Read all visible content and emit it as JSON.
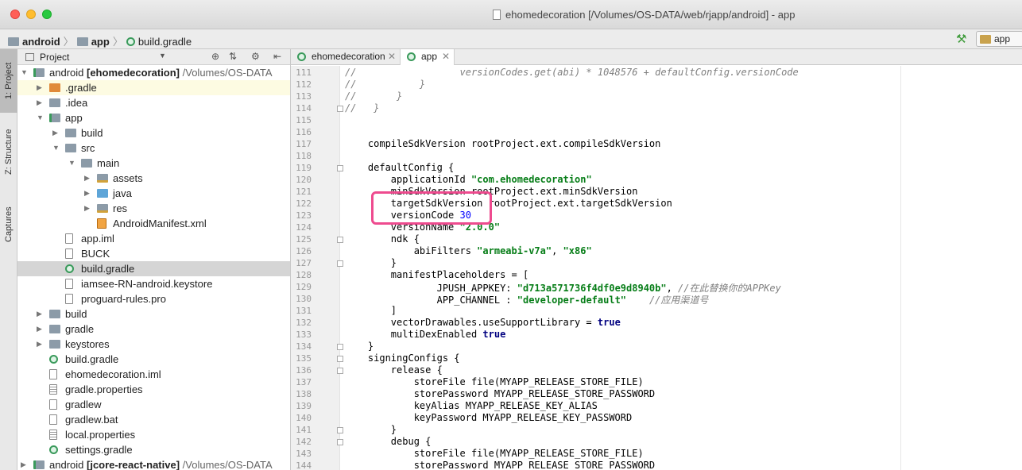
{
  "window": {
    "title": "ehomedecoration [/Volumes/OS-DATA/web/rjapp/android] - app"
  },
  "breadcrumb": {
    "items": [
      "android",
      "app",
      "build.gradle"
    ]
  },
  "toolbar": {
    "run_config": "app"
  },
  "side_tabs": [
    "1: Project",
    "Z: Structure",
    "Captures"
  ],
  "project_panel": {
    "header": "Project",
    "tree": [
      {
        "indent": 0,
        "arrow": "▼",
        "icon": "module",
        "name": "android",
        "bold": "[ehomedecoration]",
        "path": "/Volumes/OS-DATA"
      },
      {
        "indent": 1,
        "arrow": "▶",
        "icon": "folder-orange",
        "name": ".gradle",
        "hl": true
      },
      {
        "indent": 1,
        "arrow": "▶",
        "icon": "folder",
        "name": ".idea"
      },
      {
        "indent": 1,
        "arrow": "▼",
        "icon": "module",
        "name": "app"
      },
      {
        "indent": 2,
        "arrow": "▶",
        "icon": "folder",
        "name": "build"
      },
      {
        "indent": 2,
        "arrow": "▼",
        "icon": "folder",
        "name": "src"
      },
      {
        "indent": 3,
        "arrow": "▼",
        "icon": "folder",
        "name": "main"
      },
      {
        "indent": 4,
        "arrow": "▶",
        "icon": "res",
        "name": "assets"
      },
      {
        "indent": 4,
        "arrow": "▶",
        "icon": "folder-blue",
        "name": "java"
      },
      {
        "indent": 4,
        "arrow": "▶",
        "icon": "res",
        "name": "res"
      },
      {
        "indent": 4,
        "arrow": "",
        "icon": "xml",
        "name": "AndroidManifest.xml"
      },
      {
        "indent": 2,
        "arrow": "",
        "icon": "file",
        "name": "app.iml"
      },
      {
        "indent": 2,
        "arrow": "",
        "icon": "file",
        "name": "BUCK"
      },
      {
        "indent": 2,
        "arrow": "",
        "icon": "gradle",
        "name": "build.gradle",
        "selected": true
      },
      {
        "indent": 2,
        "arrow": "",
        "icon": "file",
        "name": "iamsee-RN-android.keystore"
      },
      {
        "indent": 2,
        "arrow": "",
        "icon": "file",
        "name": "proguard-rules.pro"
      },
      {
        "indent": 1,
        "arrow": "▶",
        "icon": "folder",
        "name": "build"
      },
      {
        "indent": 1,
        "arrow": "▶",
        "icon": "folder",
        "name": "gradle"
      },
      {
        "indent": 1,
        "arrow": "▶",
        "icon": "folder",
        "name": "keystores"
      },
      {
        "indent": 1,
        "arrow": "",
        "icon": "gradle",
        "name": "build.gradle"
      },
      {
        "indent": 1,
        "arrow": "",
        "icon": "file",
        "name": "ehomedecoration.iml"
      },
      {
        "indent": 1,
        "arrow": "",
        "icon": "props",
        "name": "gradle.properties"
      },
      {
        "indent": 1,
        "arrow": "",
        "icon": "file",
        "name": "gradlew"
      },
      {
        "indent": 1,
        "arrow": "",
        "icon": "file",
        "name": "gradlew.bat"
      },
      {
        "indent": 1,
        "arrow": "",
        "icon": "props",
        "name": "local.properties"
      },
      {
        "indent": 1,
        "arrow": "",
        "icon": "gradle",
        "name": "settings.gradle"
      },
      {
        "indent": 0,
        "arrow": "▶",
        "icon": "module",
        "name": "android",
        "bold": "[jcore-react-native]",
        "path": "/Volumes/OS-DATA"
      }
    ]
  },
  "editor": {
    "tabs": [
      {
        "label": "ehomedecoration",
        "active": false
      },
      {
        "label": "app",
        "active": true
      }
    ],
    "lines": [
      {
        "n": 111,
        "segs": [
          [
            "cmt",
            "//                  versionCodes.get(abi) * 1048576 + defaultConfig.versionCode"
          ]
        ]
      },
      {
        "n": 112,
        "segs": [
          [
            "cmt",
            "//           }"
          ]
        ]
      },
      {
        "n": 113,
        "segs": [
          [
            "cmt",
            "//       }"
          ]
        ]
      },
      {
        "n": 114,
        "fold": true,
        "segs": [
          [
            "cmt",
            "//   }"
          ]
        ]
      },
      {
        "n": 115,
        "segs": [
          [
            "",
            ""
          ]
        ]
      },
      {
        "n": 116,
        "segs": [
          [
            "",
            ""
          ]
        ]
      },
      {
        "n": 117,
        "segs": [
          [
            "",
            "    compileSdkVersion rootProject.ext.compileSdkVersion"
          ]
        ]
      },
      {
        "n": 118,
        "segs": [
          [
            "",
            ""
          ]
        ]
      },
      {
        "n": 119,
        "fold": true,
        "segs": [
          [
            "",
            "    defaultConfig {"
          ]
        ]
      },
      {
        "n": 120,
        "segs": [
          [
            "",
            "        applicationId "
          ],
          [
            "str",
            "\"com.ehomedecoration\""
          ]
        ]
      },
      {
        "n": 121,
        "segs": [
          [
            "",
            "        minSdkVersion rootProject.ext.minSdkVersion"
          ]
        ]
      },
      {
        "n": 122,
        "segs": [
          [
            "",
            "        targetSdkVersion rootProject.ext.targetSdkVersion"
          ]
        ]
      },
      {
        "n": 123,
        "segs": [
          [
            "",
            "        versionCode "
          ],
          [
            "num",
            "30"
          ]
        ]
      },
      {
        "n": 124,
        "segs": [
          [
            "",
            "        versionName "
          ],
          [
            "str",
            "\"2.0.0\""
          ]
        ]
      },
      {
        "n": 125,
        "fold": true,
        "segs": [
          [
            "",
            "        ndk {"
          ]
        ]
      },
      {
        "n": 126,
        "segs": [
          [
            "",
            "            abiFilters "
          ],
          [
            "str",
            "\"armeabi-v7a\""
          ],
          [
            "",
            ", "
          ],
          [
            "str",
            "\"x86\""
          ]
        ]
      },
      {
        "n": 127,
        "fold": true,
        "segs": [
          [
            "",
            "        }"
          ]
        ]
      },
      {
        "n": 128,
        "segs": [
          [
            "",
            "        manifestPlaceholders = ["
          ]
        ]
      },
      {
        "n": 129,
        "segs": [
          [
            "",
            "                JPUSH_APPKEY: "
          ],
          [
            "str",
            "\"d713a571736f4df0e9d8940b\""
          ],
          [
            "",
            ", "
          ],
          [
            "cmt",
            "//在此替换你的APPKey"
          ]
        ]
      },
      {
        "n": 130,
        "segs": [
          [
            "",
            "                APP_CHANNEL : "
          ],
          [
            "str",
            "\"developer-default\""
          ],
          [
            "",
            "    "
          ],
          [
            "cmt",
            "//应用渠道号"
          ]
        ]
      },
      {
        "n": 131,
        "segs": [
          [
            "",
            "        ]"
          ]
        ]
      },
      {
        "n": 132,
        "segs": [
          [
            "",
            "        vectorDrawables.useSupportLibrary = "
          ],
          [
            "kw",
            "true"
          ]
        ]
      },
      {
        "n": 133,
        "segs": [
          [
            "",
            "        multiDexEnabled "
          ],
          [
            "kw",
            "true"
          ]
        ]
      },
      {
        "n": 134,
        "fold": true,
        "segs": [
          [
            "",
            "    }"
          ]
        ]
      },
      {
        "n": 135,
        "fold": true,
        "segs": [
          [
            "",
            "    signingConfigs {"
          ]
        ]
      },
      {
        "n": 136,
        "fold": true,
        "segs": [
          [
            "",
            "        release {"
          ]
        ]
      },
      {
        "n": 137,
        "segs": [
          [
            "",
            "            storeFile file(MYAPP_RELEASE_STORE_FILE)"
          ]
        ]
      },
      {
        "n": 138,
        "segs": [
          [
            "",
            "            storePassword MYAPP_RELEASE_STORE_PASSWORD"
          ]
        ]
      },
      {
        "n": 139,
        "segs": [
          [
            "",
            "            keyAlias MYAPP_RELEASE_KEY_ALIAS"
          ]
        ]
      },
      {
        "n": 140,
        "segs": [
          [
            "",
            "            keyPassword MYAPP_RELEASE_KEY_PASSWORD"
          ]
        ]
      },
      {
        "n": 141,
        "fold": true,
        "segs": [
          [
            "",
            "        }"
          ]
        ]
      },
      {
        "n": 142,
        "fold": true,
        "segs": [
          [
            "",
            "        debug {"
          ]
        ]
      },
      {
        "n": 143,
        "segs": [
          [
            "",
            "            storeFile file(MYAPP_RELEASE_STORE_FILE)"
          ]
        ]
      },
      {
        "n": 144,
        "segs": [
          [
            "",
            "            storePassword MYAPP_RELEASE_STORE_PASSWORD"
          ]
        ]
      }
    ]
  },
  "colors": {
    "highlight_box": "#ee4b8f",
    "selected_row": "#d5d5d5",
    "string": "#067d17",
    "number": "#0000ff",
    "keyword": "#000080",
    "comment": "#808080"
  }
}
